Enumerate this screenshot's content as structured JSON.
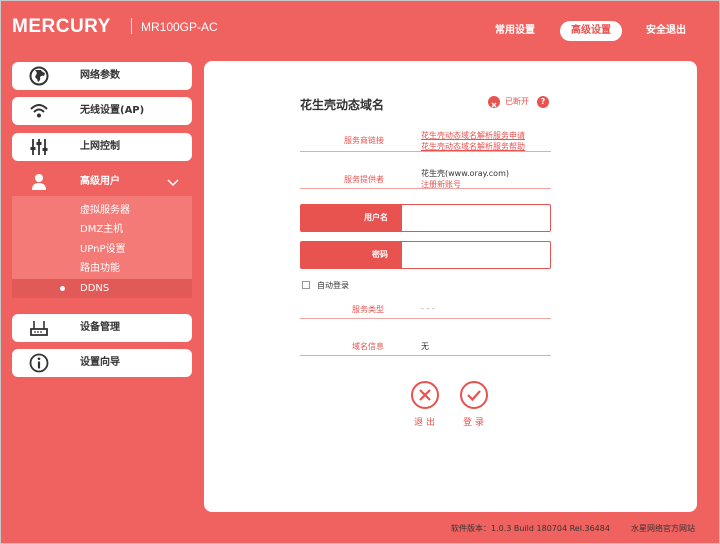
{
  "header": {
    "brand": "MERCURY",
    "model": "MR100GP-AC",
    "nav": [
      {
        "label": "常用设置"
      },
      {
        "label": "高级设置"
      },
      {
        "label": "安全退出"
      }
    ]
  },
  "sidebar": {
    "items": [
      {
        "label": "网络参数",
        "icon": "globe-icon"
      },
      {
        "label": "无线设置(AP)",
        "icon": "wifi-icon"
      },
      {
        "label": "上网控制",
        "icon": "sliders-icon"
      },
      {
        "label": "高级用户",
        "icon": "user-icon"
      },
      {
        "label": "设备管理",
        "icon": "router-icon"
      },
      {
        "label": "设置向导",
        "icon": "info-icon"
      }
    ],
    "submenu": [
      {
        "label": "虚拟服务器"
      },
      {
        "label": "DMZ主机"
      },
      {
        "label": "UPnP设置"
      },
      {
        "label": "路由功能"
      },
      {
        "label": "DDNS"
      }
    ]
  },
  "main": {
    "title": "花生壳动态域名",
    "status": "已断开",
    "help": "?",
    "service_link_label": "服务商链接",
    "service_links": [
      "花生壳动态域名解析服务申请",
      "花生壳动态域名解析服务帮助"
    ],
    "provider_label": "服务提供者",
    "provider_value": "花生壳(www.oray.com)",
    "register_link": "注册新账号",
    "username_label": "用户名",
    "username_value": "",
    "password_label": "密码",
    "password_value": "",
    "auto_login_label": "自动登录",
    "service_type_label": "服务类型",
    "service_type_value": "- - -",
    "domain_info_label": "域名信息",
    "domain_info_value": "无",
    "exit_label": "退出",
    "login_label": "登录"
  },
  "footer": {
    "version": "软件版本：1.0.3 Build 180704 Rel.36484",
    "official_site": "水星网络官方网站"
  },
  "colors": {
    "accent": "#f0625f",
    "panel": "#ffffff",
    "text": "#333333"
  }
}
